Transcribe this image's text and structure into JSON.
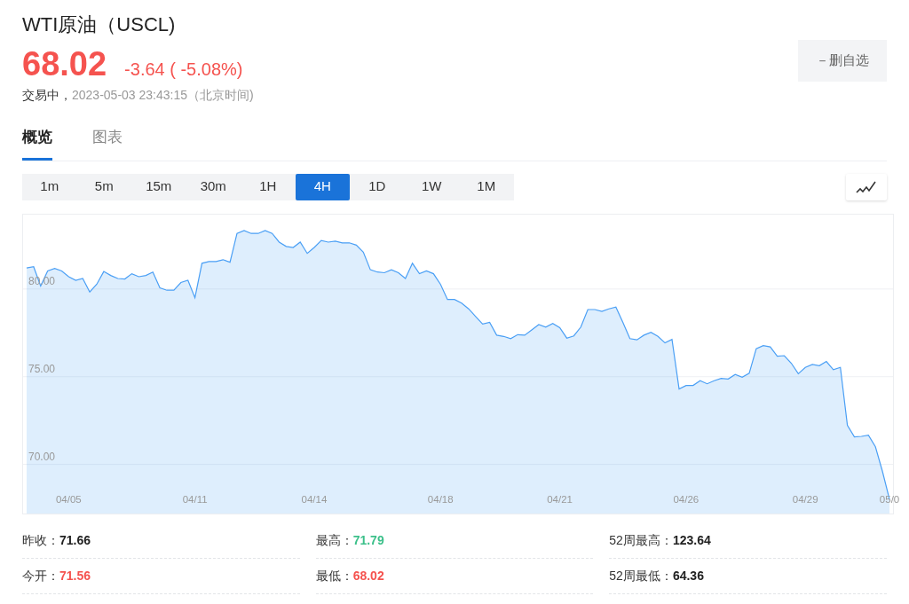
{
  "quote": {
    "title": "WTI原油（USCL)",
    "price": "68.02",
    "change": "-3.64 ( -5.08%)",
    "status": "交易中，",
    "timestamp": "2023-05-03 23:43:15（北京时间)"
  },
  "watchlist_button": {
    "label": "－删自选"
  },
  "tabs": [
    {
      "label": "概览",
      "selected": true
    },
    {
      "label": "图表",
      "selected": false
    }
  ],
  "periods": [
    {
      "label": "1m",
      "selected": false
    },
    {
      "label": "5m",
      "selected": false
    },
    {
      "label": "15m",
      "selected": false
    },
    {
      "label": "30m",
      "selected": false
    },
    {
      "label": "1H",
      "selected": false
    },
    {
      "label": "4H",
      "selected": true
    },
    {
      "label": "1D",
      "selected": false
    },
    {
      "label": "1W",
      "selected": false
    },
    {
      "label": "1M",
      "selected": false
    }
  ],
  "chart": {
    "chart_data": {
      "type": "area",
      "grid": true,
      "ylim": [
        67.2,
        84.24
      ],
      "categories": [
        null,
        null,
        null,
        null,
        null,
        null,
        "04/05",
        null,
        null,
        null,
        null,
        null,
        null,
        null,
        null,
        null,
        null,
        null,
        null,
        null,
        null,
        null,
        null,
        null,
        "04/11",
        null,
        null,
        null,
        null,
        null,
        null,
        null,
        null,
        null,
        null,
        null,
        null,
        null,
        null,
        null,
        null,
        "04/14",
        null,
        null,
        null,
        null,
        null,
        null,
        null,
        null,
        null,
        null,
        null,
        null,
        null,
        null,
        null,
        null,
        null,
        "04/18",
        null,
        null,
        null,
        null,
        null,
        null,
        null,
        null,
        null,
        null,
        null,
        null,
        null,
        null,
        null,
        null,
        "04/21",
        null,
        null,
        null,
        null,
        null,
        null,
        null,
        null,
        null,
        null,
        null,
        null,
        null,
        null,
        null,
        null,
        null,
        "04/26",
        null,
        null,
        null,
        null,
        null,
        null,
        null,
        null,
        null,
        null,
        null,
        null,
        null,
        null,
        null,
        null,
        "04/29",
        null,
        null,
        null,
        null,
        null,
        null,
        null,
        null,
        null,
        null,
        null,
        "05/0"
      ],
      "yticks": [
        {
          "value": 70,
          "label": "70.00"
        },
        {
          "value": 75,
          "label": "75.00"
        },
        {
          "value": 80,
          "label": "80.00"
        }
      ],
      "series": [
        {
          "color": "#4a9ff5",
          "values": [
            81.2,
            81.27,
            80.17,
            81.03,
            81.17,
            81.03,
            80.7,
            80.5,
            80.6,
            79.83,
            80.27,
            81.0,
            80.77,
            80.6,
            80.57,
            80.87,
            80.7,
            80.77,
            80.97,
            80.07,
            79.93,
            79.93,
            80.37,
            80.5,
            79.5,
            81.47,
            81.57,
            81.57,
            81.67,
            81.53,
            83.17,
            83.33,
            83.17,
            83.17,
            83.33,
            83.17,
            82.67,
            82.43,
            82.37,
            82.67,
            82.03,
            82.37,
            82.77,
            82.67,
            82.73,
            82.63,
            82.63,
            82.5,
            82.1,
            81.1,
            80.97,
            80.93,
            81.1,
            80.93,
            80.6,
            81.47,
            80.87,
            81.03,
            80.87,
            80.27,
            79.4,
            79.4,
            79.2,
            78.87,
            78.43,
            78.0,
            78.1,
            77.37,
            77.3,
            77.17,
            77.4,
            77.37,
            77.67,
            77.97,
            77.83,
            78.03,
            77.8,
            77.2,
            77.33,
            77.83,
            78.83,
            78.83,
            78.73,
            78.87,
            78.97,
            78.1,
            77.17,
            77.1,
            77.37,
            77.53,
            77.3,
            76.93,
            77.13,
            74.3,
            74.5,
            74.5,
            74.77,
            74.6,
            74.77,
            74.9,
            74.87,
            75.13,
            74.97,
            75.2,
            76.6,
            76.77,
            76.7,
            76.17,
            76.2,
            75.77,
            75.17,
            75.53,
            75.7,
            75.63,
            75.87,
            75.4,
            75.53,
            72.23,
            71.57,
            71.6,
            71.67,
            71.0,
            69.6,
            68.02
          ]
        }
      ]
    }
  },
  "stats": [
    {
      "label": "昨收：",
      "value": "71.66",
      "color": "#222222"
    },
    {
      "label": "最高：",
      "value": "71.79",
      "color": "#3cc08a"
    },
    {
      "label": "52周最高：",
      "value": "123.64",
      "color": "#222222"
    },
    {
      "label": "今开：",
      "value": "71.56",
      "color": "#f5534f"
    },
    {
      "label": "最低：",
      "value": "68.02",
      "color": "#f5534f"
    },
    {
      "label": "52周最低：",
      "value": "64.36",
      "color": "#222222"
    }
  ]
}
